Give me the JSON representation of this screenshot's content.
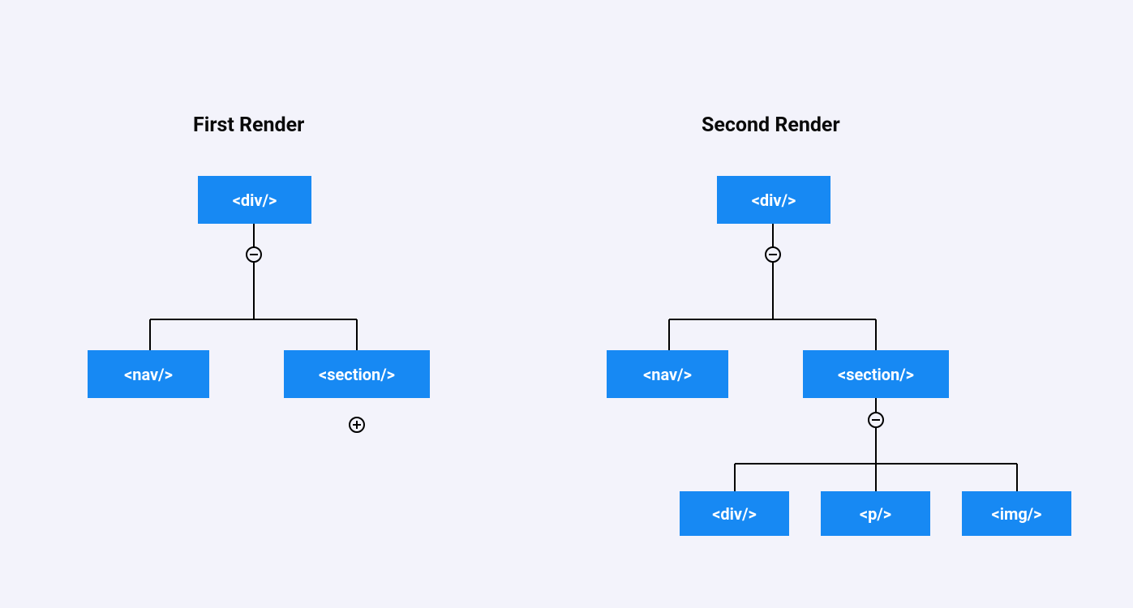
{
  "titles": {
    "first": "First Render",
    "second": "Second Render"
  },
  "first_tree": {
    "root": "<div/>",
    "children": [
      "<nav/>",
      "<section/>"
    ],
    "root_toggle": "collapse",
    "section_toggle": "expand"
  },
  "second_tree": {
    "root": "<div/>",
    "children": [
      "<nav/>",
      "<section/>"
    ],
    "section_children": [
      "<div/>",
      "<p/>",
      "<img/>"
    ],
    "root_toggle": "collapse",
    "section_toggle": "collapse"
  },
  "colors": {
    "node_bg": "#1789f3",
    "page_bg": "#f3f3fb"
  }
}
